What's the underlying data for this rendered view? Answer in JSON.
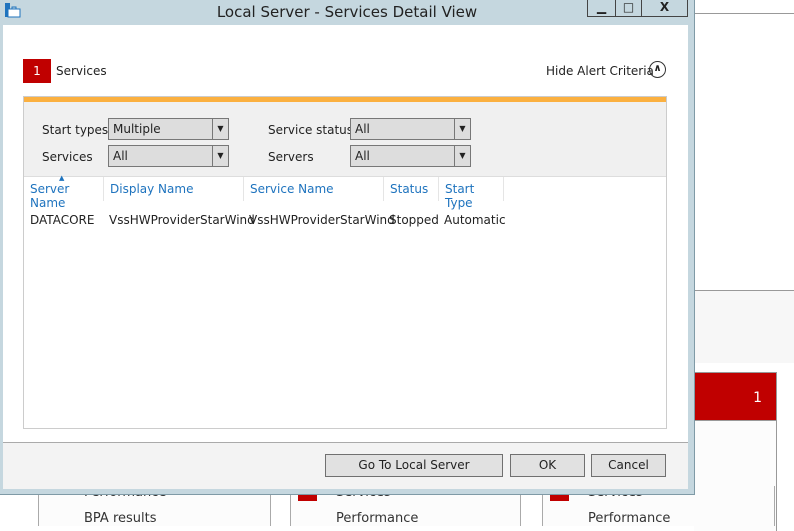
{
  "window": {
    "title": "Local Server - Services Detail View",
    "minimize": "▁",
    "maximize": "□",
    "close": "X"
  },
  "header": {
    "badge_count": "1",
    "label": "Services",
    "hide_alert": "Hide Alert Criteria",
    "hide_icon": "chevron-up-icon"
  },
  "filters": {
    "start_types": {
      "label": "Start types",
      "value": "Multiple"
    },
    "services": {
      "label": "Services",
      "value": "All"
    },
    "service_status": {
      "label": "Service status",
      "value": "All"
    },
    "servers": {
      "label": "Servers",
      "value": "All"
    }
  },
  "table": {
    "columns": [
      "Server Name",
      "Display Name",
      "Service Name",
      "Status",
      "Start Type"
    ],
    "sorted_column": "Server Name",
    "rows": [
      [
        "DATACORE",
        "VssHWProviderStarWind",
        "VssHWProviderStarWind",
        "Stopped",
        "Automatic"
      ]
    ]
  },
  "footer": {
    "goto": "Go To Local Server",
    "ok": "OK",
    "cancel": "Cancel"
  },
  "background": {
    "tile_count": "1",
    "panel1": [
      "Performance",
      "BPA results"
    ],
    "panel2": [
      "Services",
      "Performance"
    ],
    "panel3": [
      "Services",
      "Performance"
    ]
  },
  "colors": {
    "alert_red": "#c00000",
    "accent_orange": "#fbb040",
    "link_blue": "#1e73be",
    "chrome": "#c5d7df"
  }
}
